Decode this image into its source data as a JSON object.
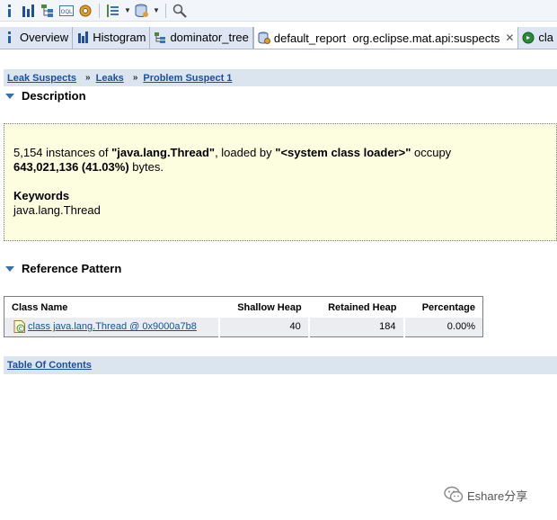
{
  "toolbar": {
    "icons": [
      "info-icon",
      "bar-chart-icon",
      "tree-icon",
      "oql-icon",
      "gear-icon",
      "export-icon",
      "database-icon",
      "search-icon"
    ],
    "oql_label": "OQL"
  },
  "tabs": [
    {
      "label": "Overview",
      "icon": "info-icon",
      "active": false
    },
    {
      "label": "Histogram",
      "icon": "bar-chart-icon",
      "active": false
    },
    {
      "label": "dominator_tree",
      "icon": "tree-icon",
      "active": false
    },
    {
      "label": "default_report  org.eclipse.mat.api:suspects",
      "icon": "report-icon",
      "active": true,
      "close": "✕"
    },
    {
      "label": "cla",
      "icon": "class-icon",
      "active": false
    }
  ],
  "breadcrumb": {
    "items": [
      "Leak Suspects",
      "Leaks",
      "Problem Suspect 1"
    ],
    "separator": "»"
  },
  "description": {
    "title": "Description",
    "line1_pre": "5,154 instances of ",
    "line1_class": "\"java.lang.Thread\"",
    "line1_mid": ", loaded by ",
    "line1_loader": "\"<system class loader>\"",
    "line1_post": " occupy",
    "line2_bytes": "643,021,136 (41.03%)",
    "line2_post": " bytes.",
    "keywords_title": "Keywords",
    "keywords": "java.lang.Thread"
  },
  "reference_pattern": {
    "title": "Reference Pattern",
    "columns": [
      "Class Name",
      "Shallow Heap",
      "Retained Heap",
      "Percentage"
    ],
    "rows": [
      {
        "class_name": "class java.lang.Thread @ 0x9000a7b8",
        "shallow": "40",
        "retained": "184",
        "percentage": "0.00%"
      }
    ]
  },
  "toc": {
    "label": "Table Of Contents"
  },
  "watermark": {
    "text": "Eshare分享"
  },
  "colors": {
    "link": "#1a4fa0",
    "desc_bg": "#fdfde0",
    "bar_bg": "#dbe5f0",
    "accent": "#3a6fb0"
  }
}
